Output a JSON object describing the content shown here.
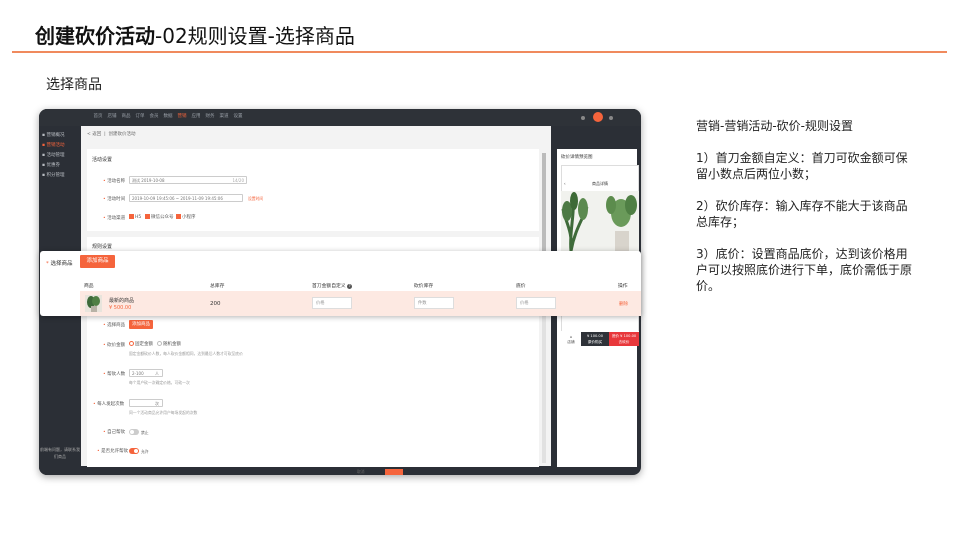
{
  "slide": {
    "title_bold": "创建砍价活动",
    "title_rest": "-02规则设置-选择商品",
    "section_label": "选择商品"
  },
  "app": {
    "topnav": [
      "首页",
      "店铺",
      "商品",
      "订单",
      "会员",
      "数据",
      "营销",
      "应用",
      "财务",
      "渠道",
      "设置"
    ],
    "active_nav_index": 6,
    "sidebar": [
      "营销概况",
      "营销活动",
      "活动管理",
      "优惠券",
      "积分管理"
    ],
    "sidebar_active_index": 1,
    "sidebar_footer": "前端有问题，请联系我们商品",
    "breadcrumb_back": "< 返回",
    "breadcrumb_title": "创建砍价活动",
    "activity_card": {
      "title": "活动设置",
      "name_label": "活动名称",
      "name_value": "测试 2019-10-08",
      "name_counter": "14/20",
      "time_label": "活动时间",
      "time_value": "2019-10-09 19:45:06 ~ 2019-11-09 19:45:06",
      "time_link": "设置时间",
      "channel_label": "活动渠道",
      "channels": [
        "H5",
        "微信公众号",
        "小程序"
      ]
    },
    "rule_card": {
      "title": "规则设置",
      "product_label": "选择商品",
      "add_button": "添加商品",
      "bargain_label": "砍价金额",
      "bargain_options": [
        "固定金额",
        "随机金额"
      ],
      "bargain_hint": "固定金额砍价人数，每人砍价金额相同，达到最后人数才可砍至底价",
      "people_label": "帮砍人数",
      "people_placeholder": "2-100",
      "people_unit": "人",
      "people_hint": "每个用户砍一次确定价格，可砍一次",
      "limit_label": "每人发起次数",
      "limit_unit": "次",
      "limit_hint": "同一个活动商品允许用户每场发起的次数",
      "help_label": "自己帮砍",
      "help_state": "禁止",
      "sync_label": "是否允许帮砍",
      "sync_state": "允许"
    },
    "preview": {
      "title": "砍价详情预览图",
      "phone_title": "商品详情",
      "btn_left_line1": "¥ 100.00",
      "btn_left_line2": "原价购买",
      "btn_right_line1": "底价 ¥ 100.00",
      "btn_right_line2": "去砍价",
      "icon_label": "店铺"
    },
    "pager_label": "取消"
  },
  "overlay": {
    "label": "选择商品",
    "add_button": "添加商品",
    "columns": [
      "商品",
      "总库存",
      "首刀金额自定义",
      "砍价库存",
      "底价",
      "操作"
    ],
    "rows": [
      {
        "name": "最新的商品",
        "price": "¥ 500.00",
        "stock": "200",
        "first_cut_placeholder": "价格",
        "bargain_stock_placeholder": "件数",
        "floor_price_placeholder": "价格",
        "action": "删除"
      }
    ]
  },
  "notes": {
    "heading": "营销-营销活动-砍价-规则设置",
    "items": [
      "1）首刀金额自定义：首刀可砍金额可保留小数点后两位小数；",
      "2）砍价库存：输入库存不能大于该商品总库存；",
      "3）底价：设置商品底价，达到该价格用户可以按照底价进行下单，底价需低于原价。"
    ]
  }
}
